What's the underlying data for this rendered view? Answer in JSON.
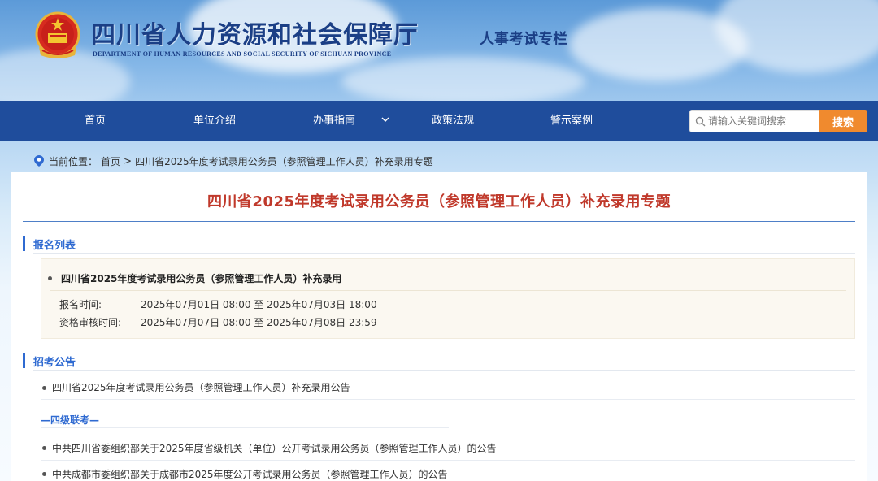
{
  "header": {
    "title": "四川省人力资源和社会保障厅",
    "subtitle": "DEPARTMENT OF HUMAN RESOURCES AND SOCIAL SECURITY OF SICHUAN PROVINCE",
    "tag": "人事考试专栏",
    "emblem_icon": "national-emblem-icon"
  },
  "nav": {
    "items": [
      {
        "label": "首页"
      },
      {
        "label": "单位介绍"
      },
      {
        "label": "办事指南"
      },
      {
        "label": "政策法规"
      },
      {
        "label": "警示案例"
      }
    ],
    "dropdown_icon": "chevron-down-icon"
  },
  "search": {
    "placeholder": "请输入关键词搜索",
    "button_label": "搜索"
  },
  "breadcrumb": {
    "prefix": "当前位置：",
    "home": "首页",
    "separator": ">",
    "current": "四川省2025年度考试录用公务员（参照管理工作人员）补充录用专题"
  },
  "main": {
    "title": "四川省2025年度考试录用公务员（参照管理工作人员）补充录用专题",
    "registration": {
      "section_label": "报名列表",
      "item_title": "四川省2025年度考试录用公务员（参照管理工作人员）补充录用",
      "rows": [
        {
          "label": "报名时间:",
          "value": "2025年07月01日 08:00 至 2025年07月03日 18:00"
        },
        {
          "label": "资格审核时间:",
          "value": "2025年07月07日 08:00 至 2025年07月08日 23:59"
        }
      ]
    },
    "announcements": {
      "section_label": "招考公告",
      "items": [
        "四川省2025年度考试录用公务员（参照管理工作人员）补充录用公告"
      ],
      "subsection_label": "—四级联考—",
      "sub_items": [
        "中共四川省委组织部关于2025年度省级机关（单位）公开考试录用公务员（参照管理工作人员）的公告",
        "中共成都市委组织部关于成都市2025年度公开考试录用公务员（参照管理工作人员）的公告"
      ]
    }
  },
  "colors": {
    "nav_bg": "#1f4d9c",
    "accent_blue": "#2f6ad1",
    "title_red": "#c0392b",
    "search_button": "#f08a2e"
  }
}
